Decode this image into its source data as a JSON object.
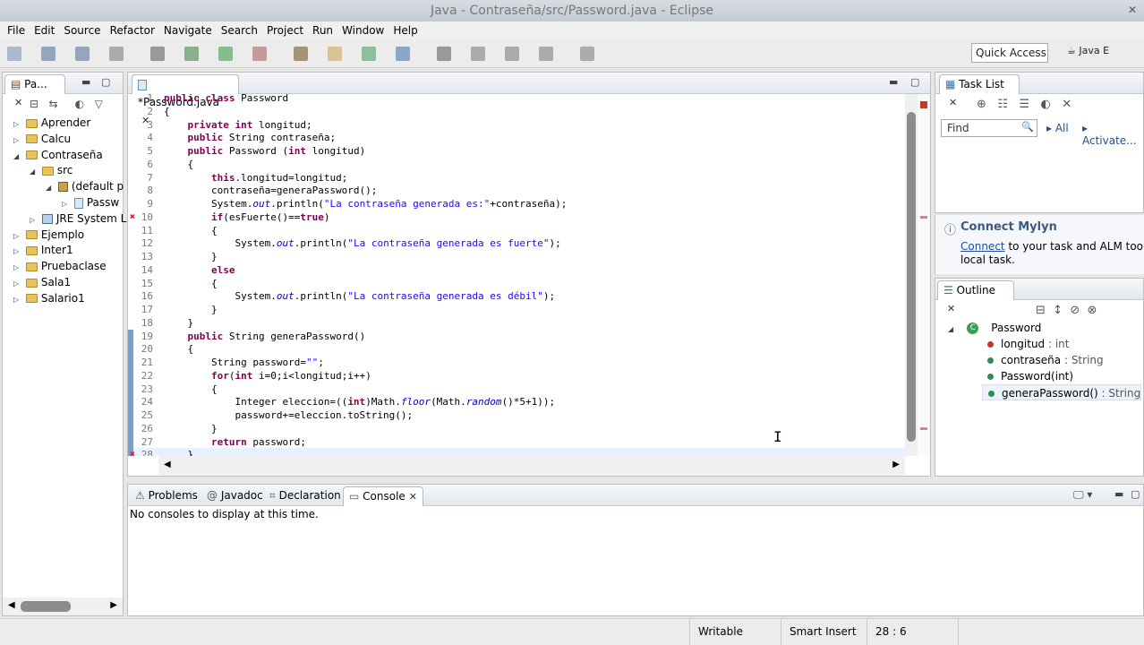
{
  "window": {
    "title": "Java - Contraseña/src/Password.java - Eclipse"
  },
  "menu": [
    "File",
    "Edit",
    "Source",
    "Refactor",
    "Navigate",
    "Search",
    "Project",
    "Run",
    "Window",
    "Help"
  ],
  "toolbar": {
    "quick_access": "Quick Access",
    "perspective": "Java E"
  },
  "package_explorer": {
    "tab_label": "Pa...",
    "items": [
      {
        "label": "Aprender",
        "indent": 0,
        "icon": "project",
        "twisty": "▷"
      },
      {
        "label": "Calcu",
        "indent": 0,
        "icon": "project",
        "twisty": "▷"
      },
      {
        "label": "Contraseña",
        "indent": 0,
        "icon": "project",
        "twisty": "◢"
      },
      {
        "label": "src",
        "indent": 1,
        "icon": "folder",
        "twisty": "◢"
      },
      {
        "label": "(default p",
        "indent": 2,
        "icon": "package",
        "twisty": "◢"
      },
      {
        "label": "Passw",
        "indent": 3,
        "icon": "java",
        "twisty": "▷"
      },
      {
        "label": "JRE System L",
        "indent": 1,
        "icon": "library",
        "twisty": "▷"
      },
      {
        "label": "Ejemplo",
        "indent": 0,
        "icon": "project",
        "twisty": "▷"
      },
      {
        "label": "Inter1",
        "indent": 0,
        "icon": "project",
        "twisty": "▷"
      },
      {
        "label": "Pruebaclase",
        "indent": 0,
        "icon": "project",
        "twisty": "▷"
      },
      {
        "label": "Sala1",
        "indent": 0,
        "icon": "project",
        "twisty": "▷"
      },
      {
        "label": "Salario1",
        "indent": 0,
        "icon": "project",
        "twisty": "▷"
      }
    ]
  },
  "editor": {
    "tab_label": "*Password.java",
    "lines": [
      {
        "n": "1",
        "html": "<span class='kw'>public class</span> Password"
      },
      {
        "n": "2",
        "html": "{"
      },
      {
        "n": "3",
        "html": "    <span class='kw'>private int</span> longitud;"
      },
      {
        "n": "4",
        "html": "    <span class='kw'>public</span> String contraseña;"
      },
      {
        "n": "5",
        "html": "    <span class='kw'>public</span> Password (<span class='kw'>int</span> longitud)"
      },
      {
        "n": "6",
        "html": "    {"
      },
      {
        "n": "7",
        "html": "        <span class='kw'>this</span>.longitud=longitud;"
      },
      {
        "n": "8",
        "html": "        contraseña=generaPassword();"
      },
      {
        "n": "9",
        "html": "        System.<span class='it'>out</span>.println(<span class='str'>\"La contraseña generada es:\"</span>+contraseña);"
      },
      {
        "n": "10",
        "html": "        <span class='kw'>if</span>(esFuerte()==<span class='kw'>true</span>)"
      },
      {
        "n": "11",
        "html": "        {"
      },
      {
        "n": "12",
        "html": "            System.<span class='it'>out</span>.println(<span class='str'>\"La contraseña generada es fuerte\"</span>);"
      },
      {
        "n": "13",
        "html": "        }"
      },
      {
        "n": "14",
        "html": "        <span class='kw'>else</span>"
      },
      {
        "n": "15",
        "html": "        {"
      },
      {
        "n": "16",
        "html": "            System.<span class='it'>out</span>.println(<span class='str'>\"La contraseña generada es débil\"</span>);"
      },
      {
        "n": "17",
        "html": "        }"
      },
      {
        "n": "18",
        "html": "    }"
      },
      {
        "n": "19",
        "html": "    <span class='kw'>public</span> String generaPassword()"
      },
      {
        "n": "20",
        "html": "    {"
      },
      {
        "n": "21",
        "html": "        String password=<span class='str'>\"\"</span>;"
      },
      {
        "n": "22",
        "html": "        <span class='kw'>for</span>(<span class='kw'>int</span> i=0;i&lt;longitud;i++)"
      },
      {
        "n": "23",
        "html": "        {"
      },
      {
        "n": "24",
        "html": "            Integer eleccion=((<span class='kw'>int</span>)Math.<span class='it'>floor</span>(Math.<span class='it'>random</span>()*5+1));"
      },
      {
        "n": "25",
        "html": "            password+=eleccion.toString();"
      },
      {
        "n": "26",
        "html": "        }"
      },
      {
        "n": "27",
        "html": "        <span class='kw'>return</span> password;"
      },
      {
        "n": "28",
        "html": "    }"
      }
    ]
  },
  "task_list": {
    "tab_label": "Task List",
    "find_placeholder": "Find",
    "all_label": "All",
    "activate_label": "Activate..."
  },
  "mylyn": {
    "title": "Connect Mylyn",
    "link": "Connect",
    "text1": " to your task and ALM tools or",
    "text2": "local task."
  },
  "outline": {
    "tab_label": "Outline",
    "class_name": "Password",
    "members": [
      {
        "label": "longitud",
        "type": " : int",
        "color": "#c0392b"
      },
      {
        "label": "contraseña",
        "type": " : String",
        "color": "#2e8b57"
      },
      {
        "label": "Password(int)",
        "type": "",
        "color": "#2e8b57"
      },
      {
        "label": "generaPassword()",
        "type": " : String",
        "color": "#2e8b57"
      }
    ]
  },
  "bottom_panel": {
    "tabs": [
      "Problems",
      "Javadoc",
      "Declaration",
      "Console"
    ],
    "message": "No consoles to display at this time."
  },
  "status": {
    "writable": "Writable",
    "insert_mode": "Smart Insert",
    "position": "28 : 6"
  }
}
